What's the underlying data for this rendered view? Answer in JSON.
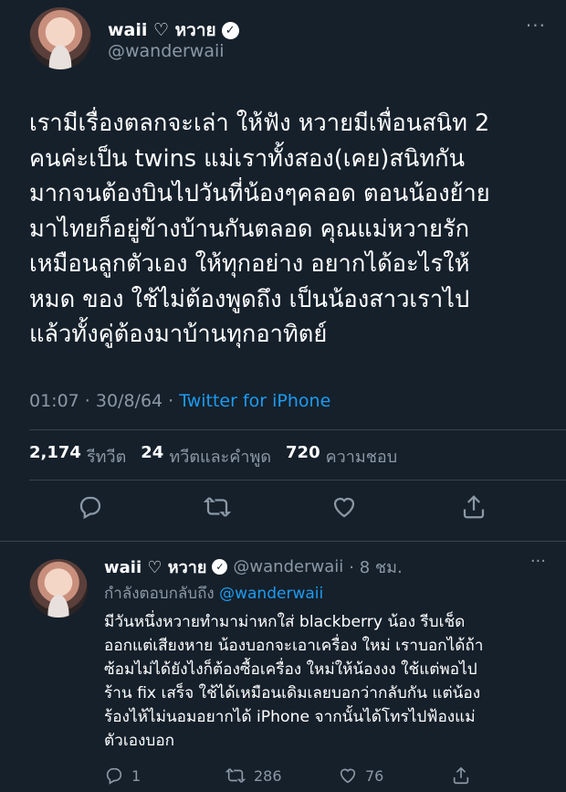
{
  "tweet": {
    "author_name": "waii ♡ หวาย",
    "handle": "@wanderwaii",
    "more_label": "···",
    "text": "เรามีเรื่องตลกจะเล่า ให้ฟัง หวายมีเพื่อนสนิท 2\nคนค่ะเป็น twins แม่เราทั้งสอง(เคย)สนิทกัน\nมากจนต้องบินไปวันที่น้องๆคลอด ตอนน้องย้าย\nมาไทยก็อยู่ข้างบ้านกันตลอด คุณแม่หวายรัก\nเหมือนลูกตัวเอง ให้ทุกอย่าง อยากได้อะไรให้\nหมด ของ ใช้ไม่ต้องพูดถึง เป็นน้องสาวเราไป\nแล้วทั้งคู่ต้องมาบ้านทุกอาทิตย์",
    "timestamp": "01:07 · 30/8/64 · ",
    "source": "Twitter for iPhone",
    "retweets_count": "2,174",
    "retweets_label": "รีทวีต",
    "quotes_count": "24",
    "quotes_label": "ทวีตและคำพูด",
    "likes_count": "720",
    "likes_label": "ความชอบ"
  },
  "reply": {
    "author_name": "waii ♡ หวาย",
    "handle": "@wanderwaii",
    "time": "· 8 ชม.",
    "more_label": "···",
    "replying_label": "กำลังตอบกลับถึง ",
    "replying_to": "@wanderwaii",
    "text": "มีวันหนึ่งหวายทำมาม่าหกใส่ blackberry น้อง รีบเช็ด\nออกแต่เสียงหาย น้องบอกจะเอาเครื่อง ใหม่ เราบอกได้ถ้า\nซ้อมไม่ได้ยังไงก็ต้องซื้อเครื่อง ใหม่ให้น้องงง ใช้แต่พอไป\nร้าน fix เสร็จ ใช้ได้เหมือนเดิมเลยบอกว่ากลับกัน แต่น้อง\nร้องไห้ไม่นอมอยากได้ iPhone จากนั้นได้โทรไปฟ้องแม่\nตัวเองบอก",
    "reply_count": "1",
    "retweet_count": "286",
    "like_count": "76"
  },
  "icons": {
    "verified": "verified-badge-icon",
    "reply": "speech-bubble-icon",
    "retweet": "retweet-arrows-icon",
    "like": "heart-icon",
    "share": "share-upload-icon"
  },
  "colors": {
    "background": "#15202b",
    "link": "#1d9bf0",
    "secondary_text": "#8b98a5",
    "divider": "#38444d"
  }
}
